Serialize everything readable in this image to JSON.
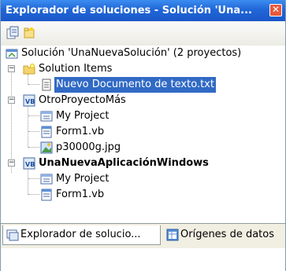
{
  "window": {
    "title": "Explorador de soluciones - Solución 'Una...",
    "close_glyph": "✕"
  },
  "toolbar": {
    "icons": [
      "properties-icon",
      "show-all-files-icon"
    ]
  },
  "tree": {
    "solution": {
      "label": "Solución 'UnaNuevaSolución'  (2 proyectos)",
      "icon": "solution-icon"
    },
    "solution_items": {
      "label": "Solution Items",
      "expanded": true,
      "icon": "folder-icon",
      "children": [
        {
          "label": "Nuevo Documento de texto.txt",
          "icon": "text-file-icon",
          "selected": true
        }
      ]
    },
    "project1": {
      "label": "OtroProyectoMás",
      "expanded": true,
      "icon": "vb-project-icon",
      "children": [
        {
          "label": "My Project",
          "icon": "my-project-icon"
        },
        {
          "label": "Form1.vb",
          "icon": "form-icon"
        },
        {
          "label": "p30000g.jpg",
          "icon": "image-file-icon"
        }
      ]
    },
    "project2": {
      "label": "UnaNuevaAplicaciónWindows",
      "expanded": true,
      "bold": true,
      "icon": "vb-project-icon",
      "children": [
        {
          "label": "My Project",
          "icon": "my-project-icon"
        },
        {
          "label": "Form1.vb",
          "icon": "form-icon"
        }
      ]
    }
  },
  "tabs": [
    {
      "label": "Explorador de solucio...",
      "active": true,
      "icon": "solution-explorer-icon"
    },
    {
      "label": "Orígenes de datos",
      "active": false,
      "icon": "data-sources-icon"
    }
  ],
  "colors": {
    "title_bar": "#2166d8",
    "selection": "#316ac5"
  }
}
